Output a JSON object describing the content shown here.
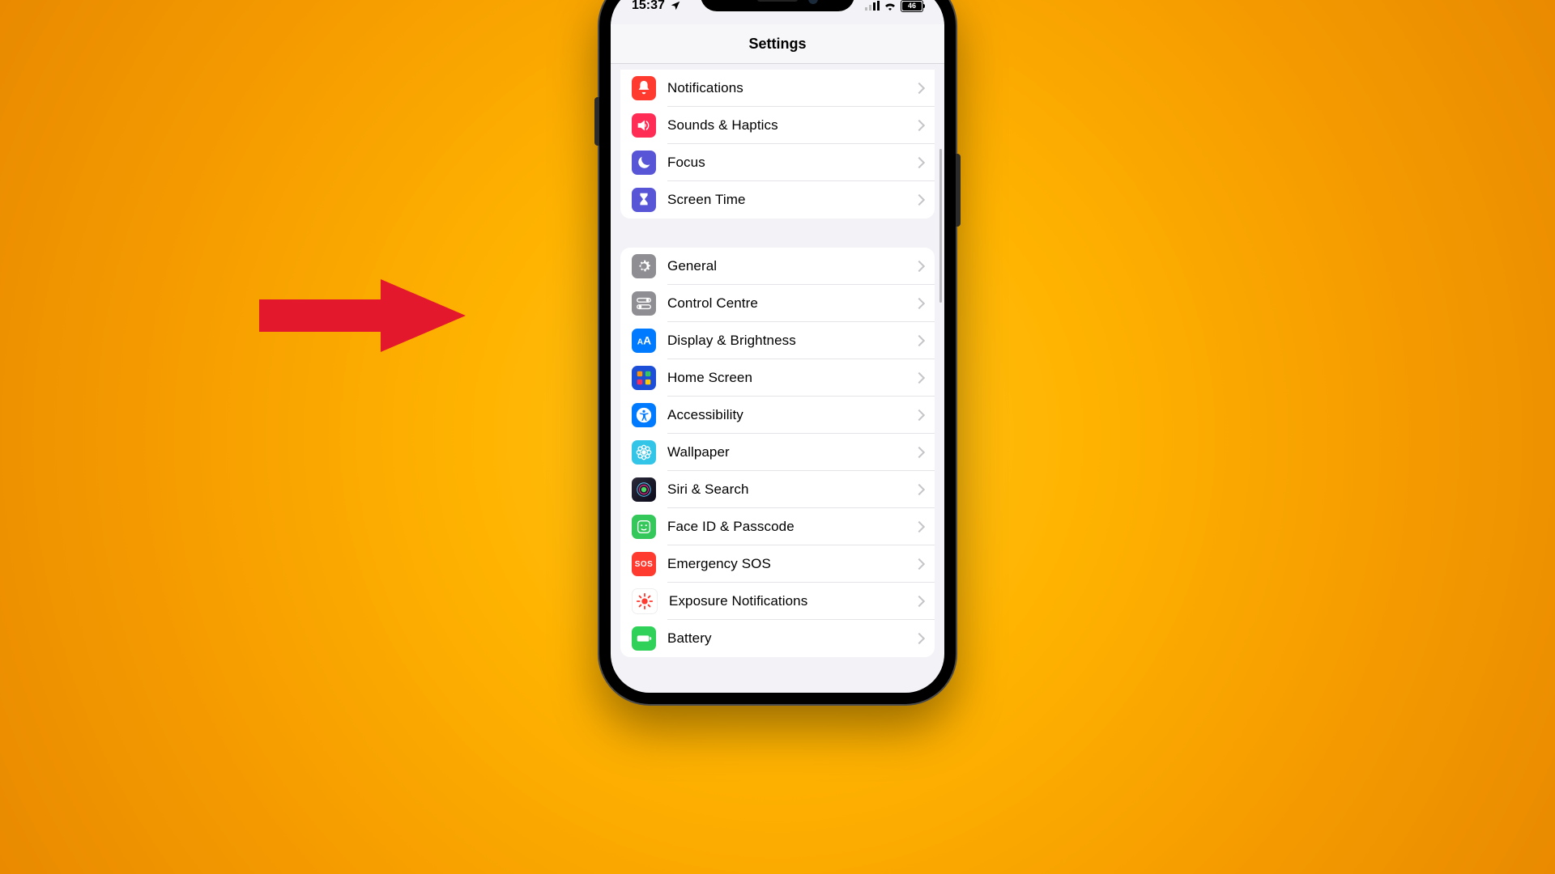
{
  "status": {
    "time": "15:37",
    "battery": "46"
  },
  "navbar": {
    "title": "Settings"
  },
  "groups": [
    {
      "rows": [
        {
          "name": "notifications",
          "label": "Notifications",
          "icon": "bell-icon",
          "bg": "bg-red"
        },
        {
          "name": "sounds-haptics",
          "label": "Sounds & Haptics",
          "icon": "speaker-icon",
          "bg": "bg-pink"
        },
        {
          "name": "focus",
          "label": "Focus",
          "icon": "moon-icon",
          "bg": "bg-purple"
        },
        {
          "name": "screen-time",
          "label": "Screen Time",
          "icon": "hourglass-icon",
          "bg": "bg-purple"
        }
      ]
    },
    {
      "rows": [
        {
          "name": "general",
          "label": "General",
          "icon": "gear-icon",
          "bg": "bg-grey"
        },
        {
          "name": "control-centre",
          "label": "Control Centre",
          "icon": "toggles-icon",
          "bg": "bg-grey"
        },
        {
          "name": "display-brightness",
          "label": "Display & Brightness",
          "icon": "aa-icon",
          "bg": "bg-blue"
        },
        {
          "name": "home-screen",
          "label": "Home Screen",
          "icon": "grid-icon",
          "bg": "bg-dblue"
        },
        {
          "name": "accessibility",
          "label": "Accessibility",
          "icon": "accessibility-icon",
          "bg": "bg-blue"
        },
        {
          "name": "wallpaper",
          "label": "Wallpaper",
          "icon": "flower-icon",
          "bg": "bg-cyan"
        },
        {
          "name": "siri-search",
          "label": "Siri & Search",
          "icon": "siri-icon",
          "bg": "siri"
        },
        {
          "name": "face-id-passcode",
          "label": "Face ID & Passcode",
          "icon": "face-icon",
          "bg": "bg-green"
        },
        {
          "name": "emergency-sos",
          "label": "Emergency SOS",
          "icon": "sos-icon",
          "bg": "bg-sos"
        },
        {
          "name": "exposure-notifications",
          "label": "Exposure Notifications",
          "icon": "exposure-icon",
          "bg": "bg-white"
        },
        {
          "name": "battery",
          "label": "Battery",
          "icon": "battery-icon",
          "bg": "bg-lime"
        }
      ]
    }
  ],
  "annotation": {
    "target_row": "control-centre"
  }
}
